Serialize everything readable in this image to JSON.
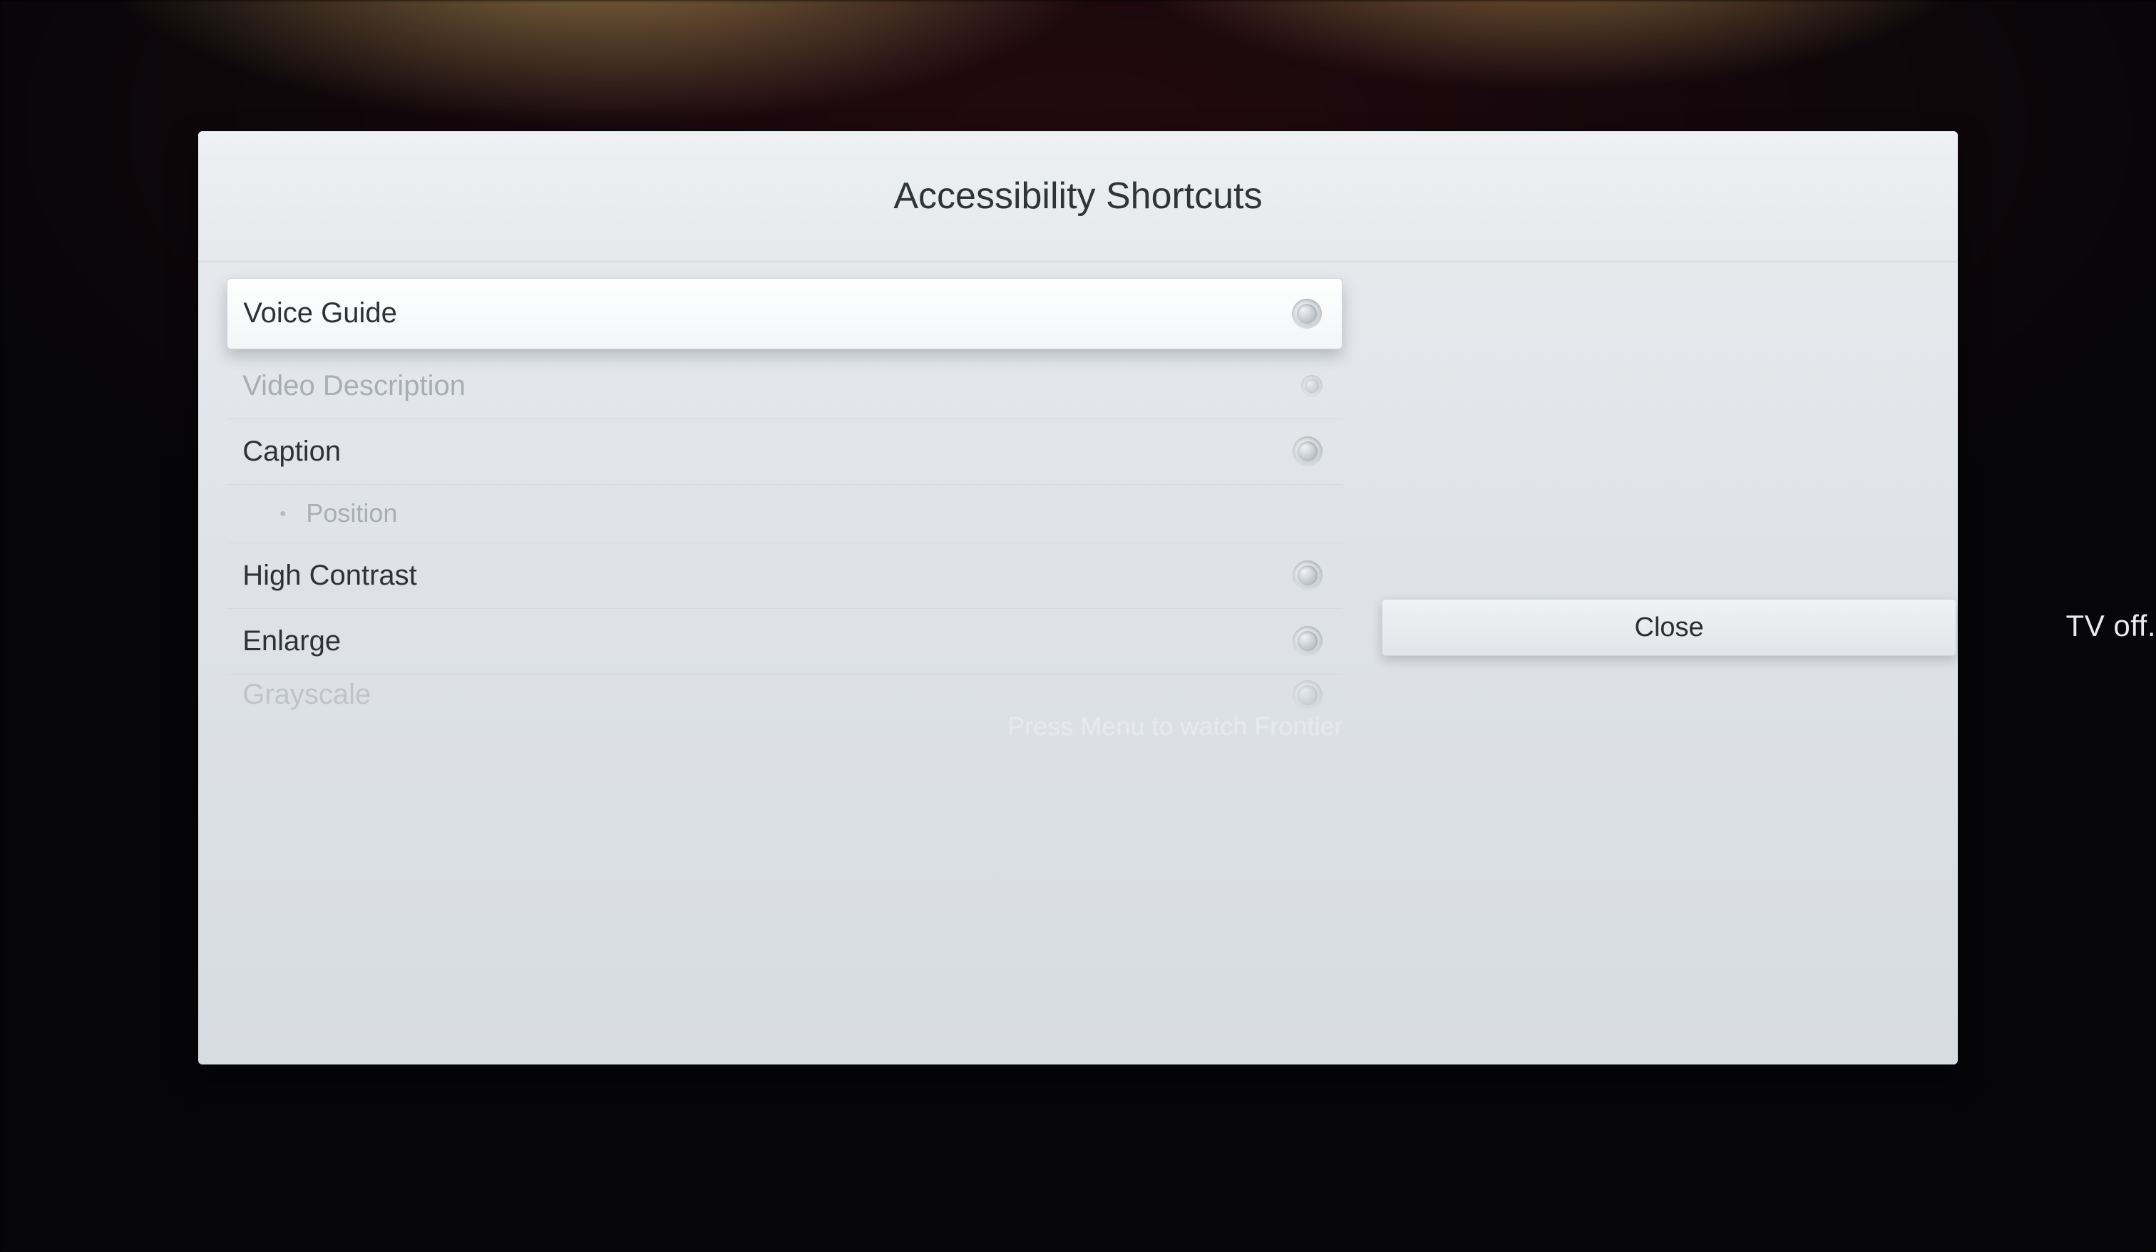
{
  "panel": {
    "title": "Accessibility Shortcuts",
    "items": [
      {
        "label": "Voice Guide",
        "state": "selected"
      },
      {
        "label": "Video Description",
        "state": "disabled"
      },
      {
        "label": "Caption",
        "state": "normal"
      },
      {
        "label": "Position",
        "state": "sub"
      },
      {
        "label": "High Contrast",
        "state": "normal"
      },
      {
        "label": "Enlarge",
        "state": "normal"
      },
      {
        "label": "Grayscale",
        "state": "partial"
      }
    ],
    "close": "Close",
    "background_hint": "Press Menu to watch Frontier"
  },
  "edge_text": "TV off."
}
